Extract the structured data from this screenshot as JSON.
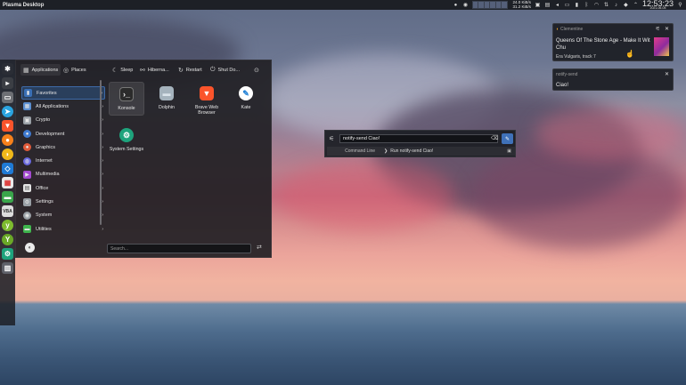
{
  "topbar": {
    "title": "Plasma Desktop",
    "net_up": "24.0 KiB/s",
    "net_down": "31.2 KiB/s",
    "time": "12:53:23",
    "date": "2021-06-05",
    "tray_icons": [
      "droplet-icon",
      "globe-icon",
      "vault-icon",
      "clipboard-icon",
      "volume-icon",
      "display-icon",
      "battery-icon",
      "bluetooth-icon",
      "wifi-icon",
      "network-icon",
      "media-icon",
      "notifications-icon",
      "arrow-up-icon",
      "pin-icon"
    ]
  },
  "dock": {
    "icons": [
      "kde-logo-icon",
      "telegram-icon",
      "brave-icon",
      "terminal-icon",
      "banana-icon",
      "vscode-icon",
      "puzzle-icon",
      "folder-icon",
      "vlc-icon",
      "yubico-icon",
      "settings-icon",
      "trash-icon"
    ]
  },
  "launcher": {
    "tab_applications": "Applications",
    "tab_places": "Places",
    "sleep": "Sleep",
    "hibernate": "Hiberna...",
    "restart": "Restart",
    "shutdown": "Shut Do...",
    "categories": [
      {
        "label": "Favorites",
        "color": "#3a6fb5"
      },
      {
        "label": "All Applications",
        "color": "#5b8fd1"
      },
      {
        "label": "Crypto",
        "color": "#9aa0a6"
      },
      {
        "label": "Development",
        "color": "#3f7ad1"
      },
      {
        "label": "Graphics",
        "color": "#e05a3a"
      },
      {
        "label": "Internet",
        "color": "#6a6ae0"
      },
      {
        "label": "Multimedia",
        "color": "#a44ad1"
      },
      {
        "label": "Office",
        "color": "#8a8a8a"
      },
      {
        "label": "Settings",
        "color": "#9aa0a6"
      },
      {
        "label": "System",
        "color": "#9aa0a6"
      },
      {
        "label": "Utilities",
        "color": "#3fb54d"
      }
    ],
    "apps": [
      {
        "label": "Konsole",
        "icon_color": "#2b2b2b"
      },
      {
        "label": "Dolphin",
        "icon_color": "#8c9aa5"
      },
      {
        "label": "Brave Web Browser",
        "icon_color": "#fb542b"
      },
      {
        "label": "Kate",
        "icon_color": "#ffffff"
      },
      {
        "label": "System Settings",
        "icon_color": "#1ea37c"
      }
    ],
    "search_placeholder": "Search..."
  },
  "krunner": {
    "query": "notify-send Ciao!",
    "result_category": "Command Line",
    "result_label": "Run notify-send Ciao!"
  },
  "notifications": [
    {
      "app": "Clementine",
      "title": "Queens Of The Stone Age - Make It Wit Chu",
      "body": "Era Vulgaris, track 7"
    },
    {
      "app": "notify-send",
      "title": "Ciao!"
    }
  ]
}
